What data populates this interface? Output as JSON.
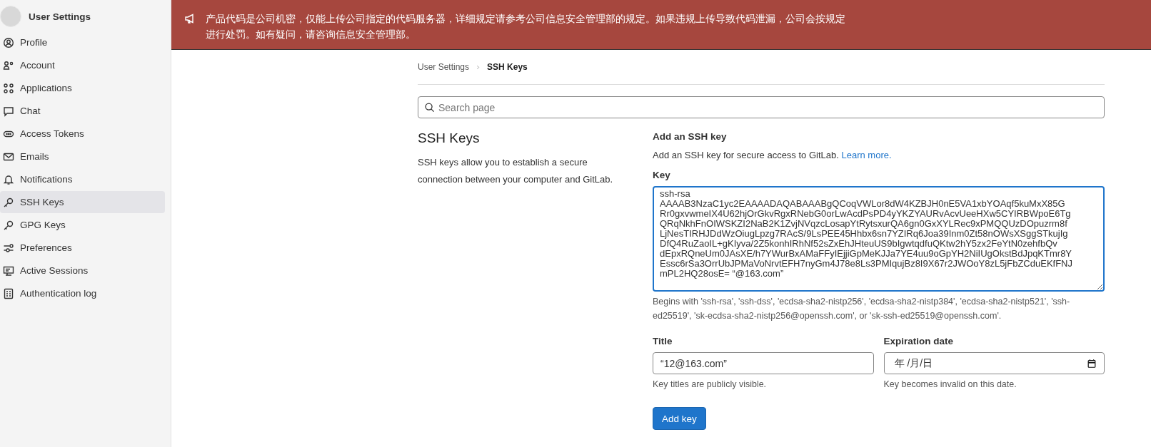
{
  "sidebar": {
    "title": "User Settings",
    "items": [
      {
        "label": "Profile",
        "selected": false
      },
      {
        "label": "Account",
        "selected": false
      },
      {
        "label": "Applications",
        "selected": false
      },
      {
        "label": "Chat",
        "selected": false
      },
      {
        "label": "Access Tokens",
        "selected": false
      },
      {
        "label": "Emails",
        "selected": false
      },
      {
        "label": "Notifications",
        "selected": false
      },
      {
        "label": "SSH Keys",
        "selected": true
      },
      {
        "label": "GPG Keys",
        "selected": false
      },
      {
        "label": "Preferences",
        "selected": false
      },
      {
        "label": "Active Sessions",
        "selected": false
      },
      {
        "label": "Authentication log",
        "selected": false
      }
    ]
  },
  "banner": {
    "text": "产品代码是公司机密，仅能上传公司指定的代码服务器，详细规定请参考公司信息安全管理部的规定。如果违规上传导致代码泄漏，公司会按规定进行处罚。如有疑问，请咨询信息安全管理部。"
  },
  "breadcrumb": [
    {
      "label": "User Settings",
      "current": false
    },
    {
      "label": "SSH Keys",
      "current": true
    }
  ],
  "search": {
    "placeholder": "Search page"
  },
  "section": {
    "title": "SSH Keys",
    "description": "SSH keys allow you to establish a secure connection between your computer and GitLab."
  },
  "form": {
    "title": "Add an SSH key",
    "intro": "Add an SSH key for secure access to GitLab.",
    "intro_link": "Learn more.",
    "key": {
      "label": "Key",
      "value": "ssh-rsa\nAAAAB3NzaC1yc2EAAAADAQABAAABgQCoqVWLor8dW4KZBJH0nE5VA1xbYOAqf5kuMxX85G\nRr0gxvwmeIX4U62hjOrGkvRgxRNebG0orLwAcdPsPD4yYKZYAURvAcvUeeHXw5CYIRBWpoE6Tg\nQRqNkhFnOIWSKZI2NaB2K1ZvjNVqzcLosapYtRytsxurQA6gn0GxXYLRec9xPMQQUzDOpuzrm8f\nLjNesTIRHJDdWzOiugLpzg7RAcS/9LsPEE45Hhbx6sn7YZIRq6Joa39Inm0Zt58nOWsXSggSTkujIg\nDfQ4RuZaoIL+gKIyva/2Z5konhIRhNf52sZxEhJHteuUS9bIgwtqdfuQKtw2hY5zx2FeYtN0zehfbQv\ndEpxRQneUm0JAsXE/h7YWurBxAMaFFyIEjjiGpMeKJJa7YE4uu9oGpYH2NiIUgOkstBdJpqKTmr8Y\nEssc6rSa3OrrUbJPMaVoNrvtEFH7nyGm4J78e8Ls3PMIqujBz8I9X67r2JWOoY8zL5jFbZCduEKfFNJ\nmPL2HQ28osE= “@163.com”",
      "hint": "Begins with 'ssh-rsa', 'ssh-dss', 'ecdsa-sha2-nistp256', 'ecdsa-sha2-nistp384', 'ecdsa-sha2-nistp521', 'ssh-ed25519', 'sk-ecdsa-sha2-nistp256@openssh.com', or 'sk-ssh-ed25519@openssh.com'."
    },
    "title_field": {
      "label": "Title",
      "value": "“12@163.com”",
      "hint": "Key titles are publicly visible."
    },
    "expiration": {
      "label": "Expiration date",
      "value": "年 /月/日",
      "hint": "Key becomes invalid on this date."
    },
    "submit": "Add key"
  }
}
